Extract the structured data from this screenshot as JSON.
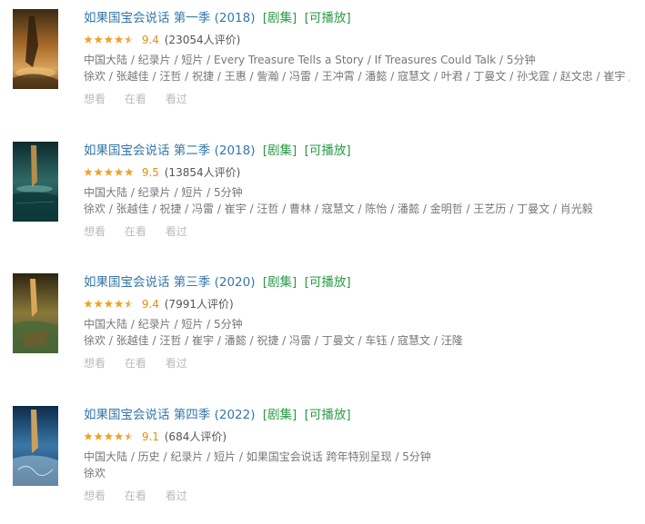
{
  "palette": {
    "title": "#3377aa",
    "tag": "#2a9a45",
    "score": "#e09015",
    "star_full": "#f4a11a",
    "star_empty": "#dcdcdc"
  },
  "items": [
    {
      "title": "如果国宝会说话 第一季 (2018)",
      "tag_play": "[剧集]",
      "tag_avail": "[可播放]",
      "rating": 4.5,
      "score": "9.4",
      "votes": "(23054人评价)",
      "meta": "中国大陆 / 纪录片 / 短片 / Every Treasure Tells a Story / If Treasures Could Talk / 5分钟",
      "cast": "徐欢 / 张越佳 / 汪哲 / 祝捷 / 王惠 / 訾瀚 / 冯雷 / 王冲霄 / 潘懿 / 寇慧文 / 叶君 / 丁曼文 / 孙戈霆 / 赵文忠 / 崔宇 / 汪…",
      "actions": [
        "想看",
        "在看",
        "看过"
      ],
      "poster_theme": "amber-sculpture"
    },
    {
      "title": "如果国宝会说话 第二季 (2018)",
      "tag_play": "[剧集]",
      "tag_avail": "[可播放]",
      "rating": 5,
      "score": "9.5",
      "votes": "(13854人评价)",
      "meta": "中国大陆 / 纪录片 / 短片 / 5分钟",
      "cast": "徐欢 / 张越佳 / 祝捷 / 冯雷 / 崔宇 / 汪哲 / 曹林 / 寇慧文 / 陈怡 / 潘懿 / 金明哲 / 王艺历 / 丁曼文 / 肖光毅",
      "actions": [
        "想看",
        "在看",
        "看过"
      ],
      "poster_theme": "teal-water"
    },
    {
      "title": "如果国宝会说话 第三季 (2020)",
      "tag_play": "[剧集]",
      "tag_avail": "[可播放]",
      "rating": 4.5,
      "score": "9.4",
      "votes": "(7991人评价)",
      "meta": "中国大陆 / 纪录片 / 短片 / 5分钟",
      "cast": "徐欢 / 张越佳 / 汪哲 / 崔宇 / 潘懿 / 祝捷 / 冯雷 / 丁曼文 / 车钰 / 寇慧文 / 汪隆",
      "actions": [
        "想看",
        "在看",
        "看过"
      ],
      "poster_theme": "olive-pavilion"
    },
    {
      "title": "如果国宝会说话 第四季 (2022)",
      "tag_play": "[剧集]",
      "tag_avail": "[可播放]",
      "rating": 4.5,
      "score": "9.1",
      "votes": "(684人评价)",
      "meta": "中国大陆 / 历史 / 纪录片 / 短片 / 如果国宝会说话 跨年特别呈现 / 5分钟",
      "cast": "徐欢",
      "actions": [
        "想看",
        "在看",
        "看过"
      ],
      "poster_theme": "blue-ink"
    }
  ]
}
